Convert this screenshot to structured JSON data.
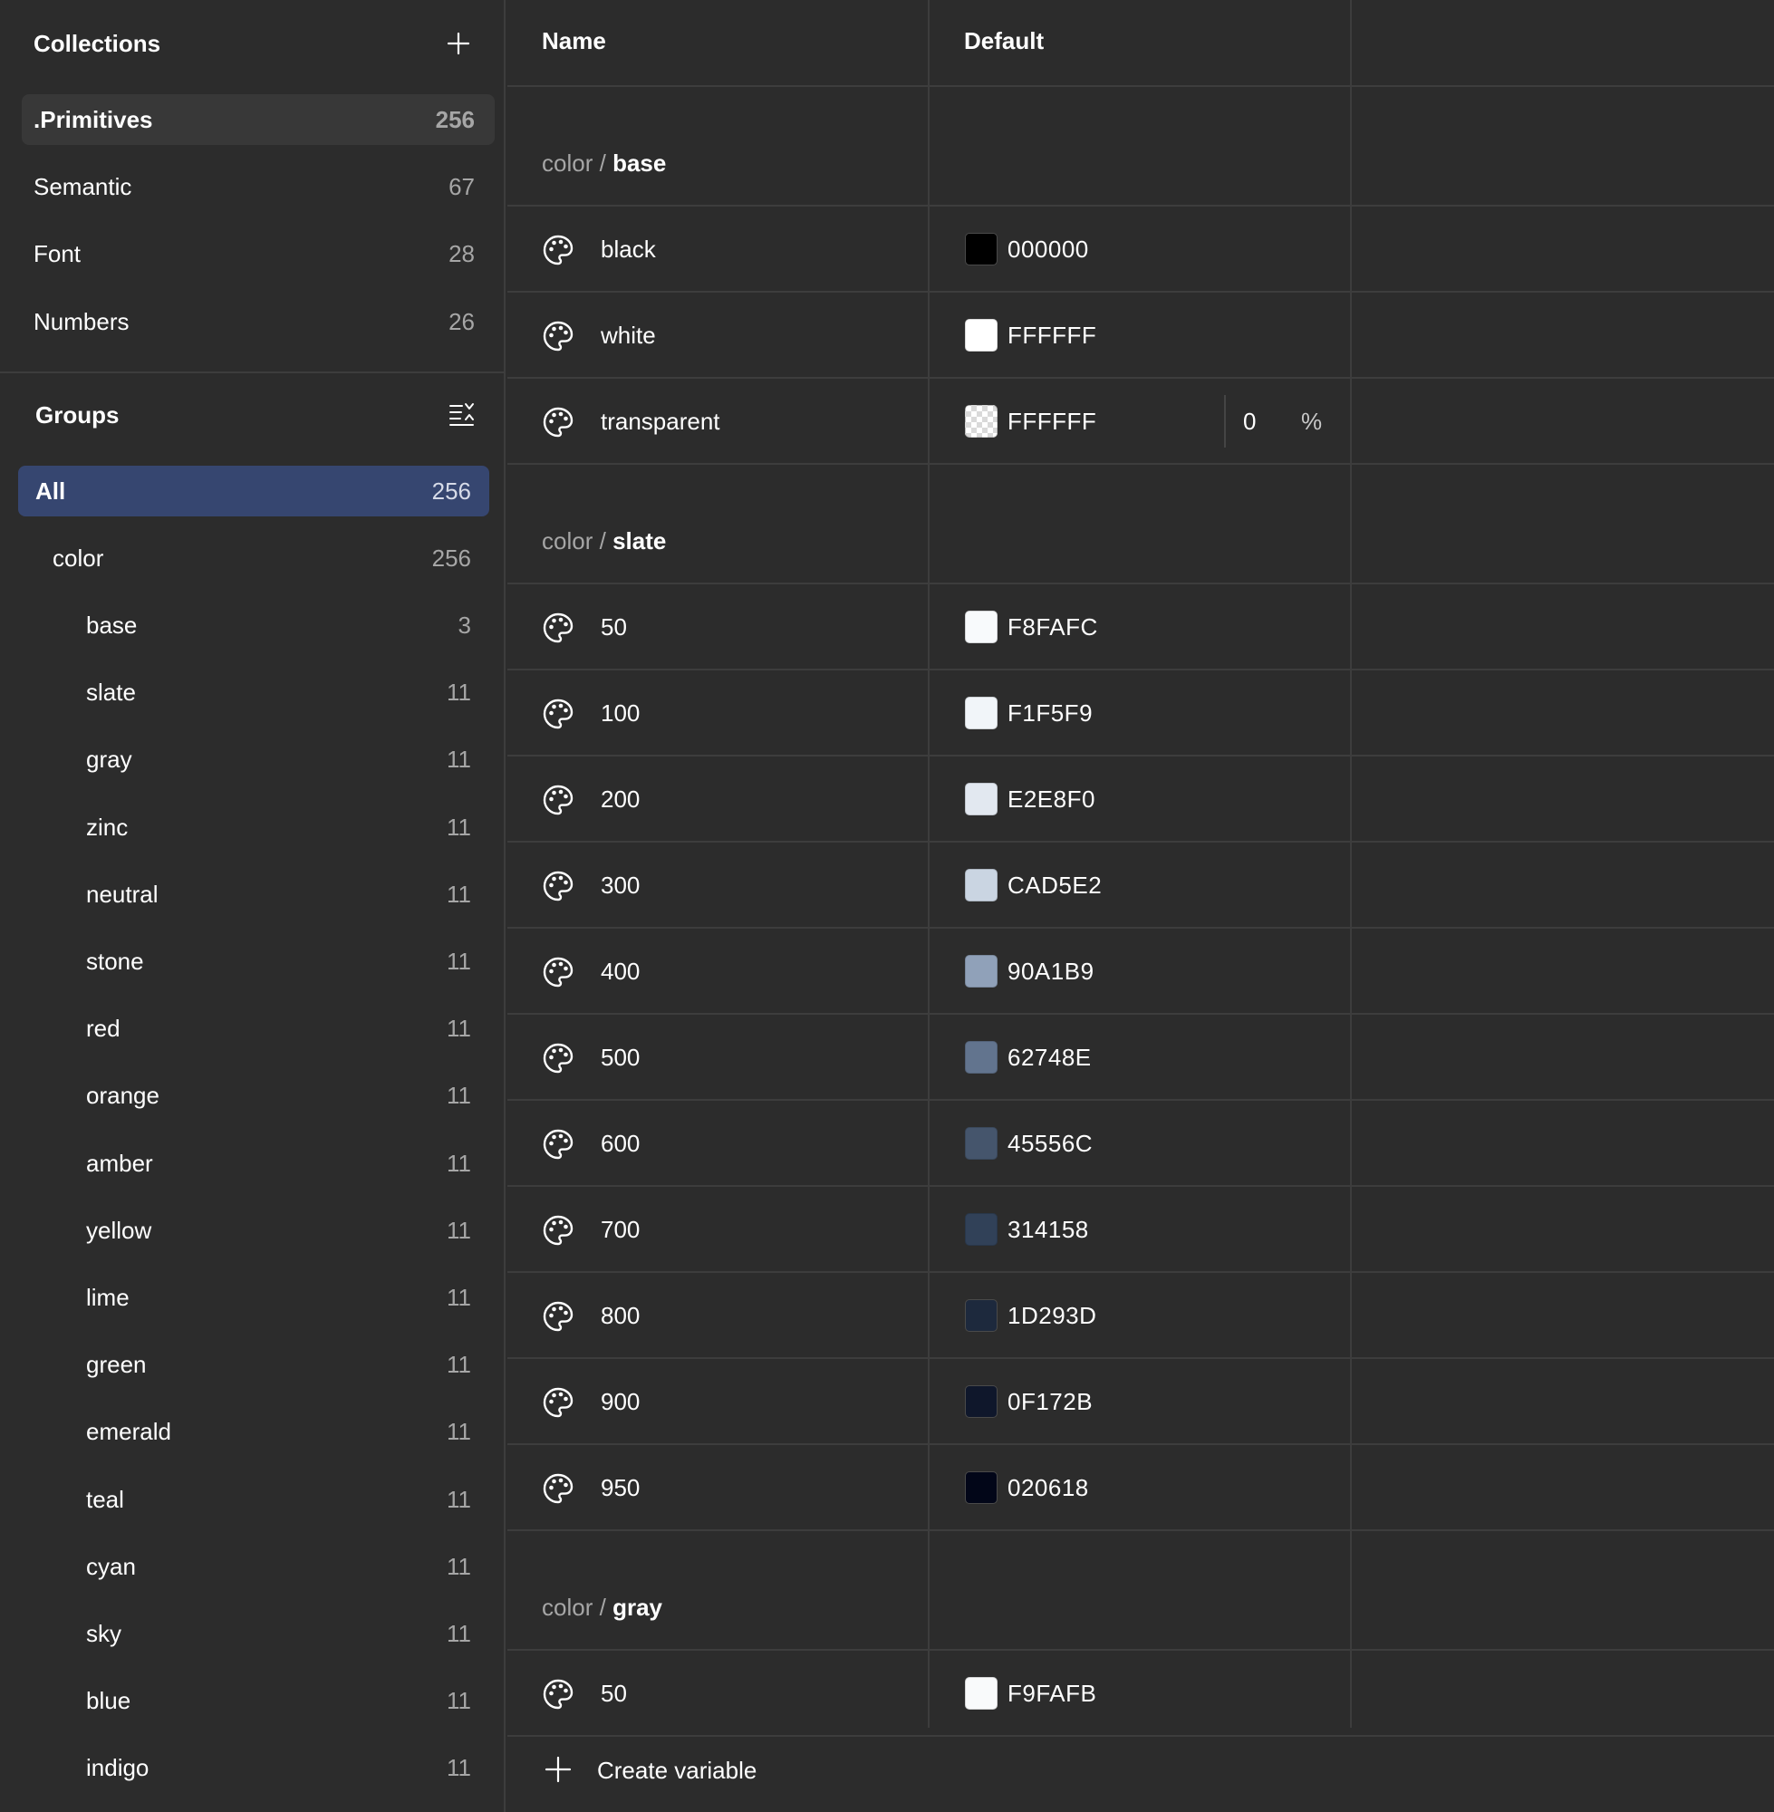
{
  "sidebar": {
    "collections_title": "Collections",
    "collections": [
      {
        "label": ".Primitives",
        "count": "256",
        "selected": true
      },
      {
        "label": "Semantic",
        "count": "67"
      },
      {
        "label": "Font",
        "count": "28"
      },
      {
        "label": "Numbers",
        "count": "26"
      }
    ],
    "groups_title": "Groups",
    "groups": [
      {
        "label": "All",
        "count": "256",
        "selected": true,
        "level": 0
      },
      {
        "label": "color",
        "count": "256",
        "level": 1
      },
      {
        "label": "base",
        "count": "3",
        "level": 2
      },
      {
        "label": "slate",
        "count": "11",
        "level": 2
      },
      {
        "label": "gray",
        "count": "11",
        "level": 2
      },
      {
        "label": "zinc",
        "count": "11",
        "level": 2
      },
      {
        "label": "neutral",
        "count": "11",
        "level": 2
      },
      {
        "label": "stone",
        "count": "11",
        "level": 2
      },
      {
        "label": "red",
        "count": "11",
        "level": 2
      },
      {
        "label": "orange",
        "count": "11",
        "level": 2
      },
      {
        "label": "amber",
        "count": "11",
        "level": 2
      },
      {
        "label": "yellow",
        "count": "11",
        "level": 2
      },
      {
        "label": "lime",
        "count": "11",
        "level": 2
      },
      {
        "label": "green",
        "count": "11",
        "level": 2
      },
      {
        "label": "emerald",
        "count": "11",
        "level": 2
      },
      {
        "label": "teal",
        "count": "11",
        "level": 2
      },
      {
        "label": "cyan",
        "count": "11",
        "level": 2
      },
      {
        "label": "sky",
        "count": "11",
        "level": 2
      },
      {
        "label": "blue",
        "count": "11",
        "level": 2
      },
      {
        "label": "indigo",
        "count": "11",
        "level": 2
      }
    ]
  },
  "table": {
    "columns": [
      "Name",
      "Default"
    ],
    "sections": [
      {
        "prefix": "color",
        "separator": "/",
        "name": "base",
        "rows": [
          {
            "name": "black",
            "hex": "000000",
            "swatch": "#000000"
          },
          {
            "name": "white",
            "hex": "FFFFFF",
            "swatch": "#FFFFFF"
          },
          {
            "name": "transparent",
            "hex": "FFFFFF",
            "swatch": "#FFFFFF",
            "transparent": true,
            "opacity": "0",
            "opacity_unit": "%"
          }
        ]
      },
      {
        "prefix": "color",
        "separator": "/",
        "name": "slate",
        "rows": [
          {
            "name": "50",
            "hex": "F8FAFC",
            "swatch": "#F8FAFC"
          },
          {
            "name": "100",
            "hex": "F1F5F9",
            "swatch": "#F1F5F9"
          },
          {
            "name": "200",
            "hex": "E2E8F0",
            "swatch": "#E2E8F0"
          },
          {
            "name": "300",
            "hex": "CAD5E2",
            "swatch": "#CAD5E2"
          },
          {
            "name": "400",
            "hex": "90A1B9",
            "swatch": "#90A1B9"
          },
          {
            "name": "500",
            "hex": "62748E",
            "swatch": "#62748E"
          },
          {
            "name": "600",
            "hex": "45556C",
            "swatch": "#45556C"
          },
          {
            "name": "700",
            "hex": "314158",
            "swatch": "#314158"
          },
          {
            "name": "800",
            "hex": "1D293D",
            "swatch": "#1D293D"
          },
          {
            "name": "900",
            "hex": "0F172B",
            "swatch": "#0F172B"
          },
          {
            "name": "950",
            "hex": "020618",
            "swatch": "#020618"
          }
        ]
      },
      {
        "prefix": "color",
        "separator": "/",
        "name": "gray",
        "rows": [
          {
            "name": "50",
            "hex": "F9FAFB",
            "swatch": "#F9FAFB"
          }
        ]
      }
    ],
    "create_label": "Create variable"
  },
  "icons": {
    "add_collection": "plus-icon",
    "groups_toggle": "collapse-list-icon",
    "variable_type": "palette-icon",
    "create": "plus-icon"
  },
  "colors": {
    "background": "#2c2c2c",
    "selected_collection": "#383838",
    "selected_group": "#364670",
    "divider": "#3d3d3d"
  }
}
